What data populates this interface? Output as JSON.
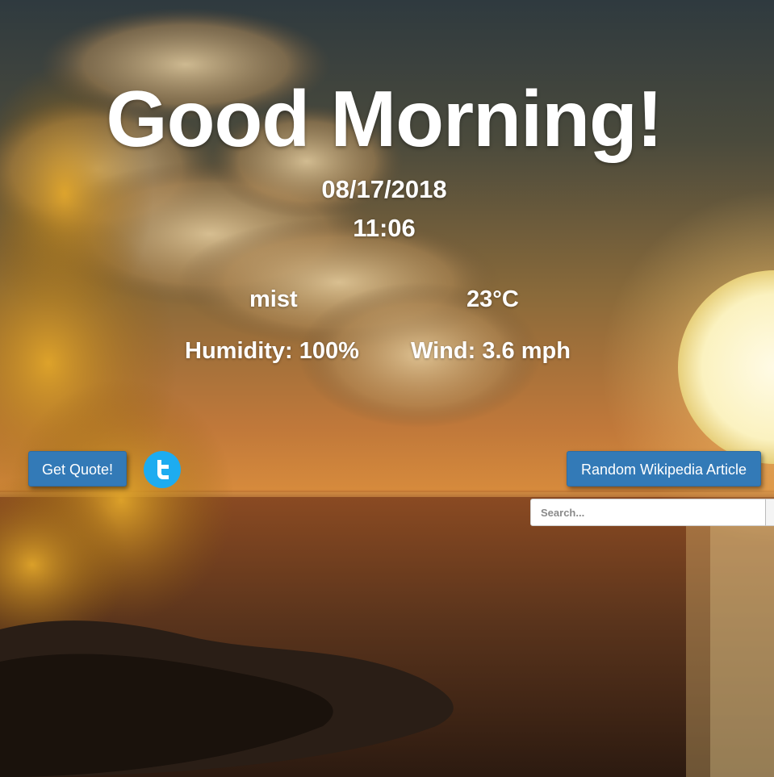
{
  "greeting": "Good Morning!",
  "date": "08/17/2018",
  "time": "11:06",
  "weather": {
    "condition": "mist",
    "temperature": "23°C",
    "humidity": "Humidity: 100%",
    "wind": "Wind: 3.6 mph"
  },
  "actions": {
    "quote_label": "Get Quote!",
    "twitter_icon": "twitter-icon",
    "wiki_label": "Random Wikipedia Article"
  },
  "search": {
    "placeholder": "Search..."
  },
  "colors": {
    "button": "#337ab7",
    "twitter": "#1dacf0",
    "text": "#ffffff"
  }
}
